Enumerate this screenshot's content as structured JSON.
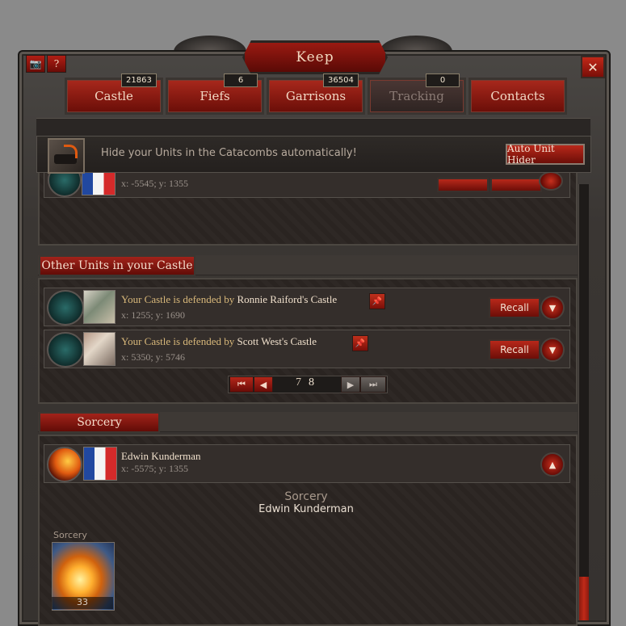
{
  "window": {
    "title": "Keep",
    "close_symbol": "✕",
    "camera_symbol": "📷",
    "help_symbol": "?"
  },
  "tabs": [
    {
      "label": "Castle",
      "count": "21863",
      "active": true
    },
    {
      "label": "Fiefs",
      "count": "6"
    },
    {
      "label": "Garrisons",
      "count": "36504"
    },
    {
      "label": "Tracking",
      "count": "0",
      "disabled": true
    },
    {
      "label": "Contacts"
    }
  ],
  "auto_hider": {
    "message": "Hide your Units in the Catacombs automatically!",
    "button_label": "Auto Unit Hider"
  },
  "top_partial_row": {
    "coords_fragment": "x: -5545; y: 1355"
  },
  "other_units": {
    "header": "Other Units in your Castle",
    "rows": [
      {
        "prefix": "Your Castle is defended by",
        "name": "Ronnie Raiford's Castle",
        "coords": "x: 1255; y: 1690",
        "recall": "Recall"
      },
      {
        "prefix": "Your Castle is defended by",
        "name": "Scott West's Castle",
        "coords": "x: 5350; y: 5746",
        "recall": "Recall"
      }
    ],
    "pager": {
      "first": "⏮",
      "prev": "◀",
      "page_a": "7",
      "page_b": "8",
      "next": "▶",
      "last": "⏭"
    }
  },
  "sorcery": {
    "header": "Sorcery",
    "row": {
      "name": "Edwin Kunderman",
      "coords": "x: -5575; y: 1355"
    },
    "detail_title": "Sorcery",
    "detail_name": "Edwin Kunderman",
    "spell_label": "Sorcery",
    "spell_count": "33"
  },
  "colors": {
    "accent_red": "#a2231a",
    "gold_text": "#d8b87a"
  }
}
